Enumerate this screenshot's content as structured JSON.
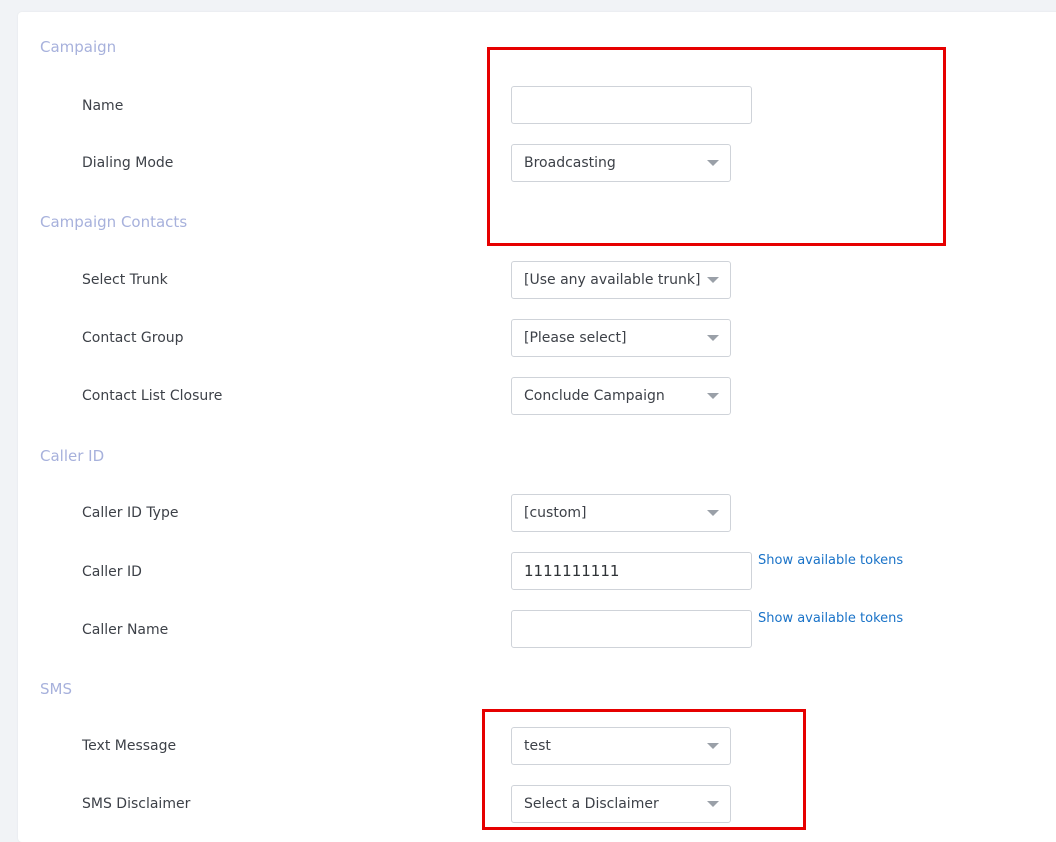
{
  "sections": {
    "campaign": "Campaign",
    "contacts": "Campaign Contacts",
    "caller_id": "Caller ID",
    "sms": "SMS"
  },
  "fields": {
    "name": {
      "label": "Name",
      "value": ""
    },
    "dialing_mode": {
      "label": "Dialing Mode",
      "value": "Broadcasting"
    },
    "select_trunk": {
      "label": "Select Trunk",
      "value": "[Use any available trunk]"
    },
    "contact_group": {
      "label": "Contact Group",
      "value": "[Please select]"
    },
    "contact_list_closure": {
      "label": "Contact List Closure",
      "value": "Conclude Campaign"
    },
    "caller_id_type": {
      "label": "Caller ID Type",
      "value": "[custom]"
    },
    "caller_id": {
      "label": "Caller ID",
      "value": "1111111111",
      "link": "Show available tokens"
    },
    "caller_name": {
      "label": "Caller Name",
      "value": "",
      "link": "Show available tokens"
    },
    "text_message": {
      "label": "Text Message",
      "value": "test"
    },
    "sms_disclaimer": {
      "label": "SMS Disclaimer",
      "value": "Select a Disclaimer"
    }
  },
  "colors": {
    "section_title": "#a7b1dc",
    "link": "#1a73c8",
    "highlight": "#e60000"
  },
  "icons": {
    "dropdown": "caret-down-icon"
  }
}
